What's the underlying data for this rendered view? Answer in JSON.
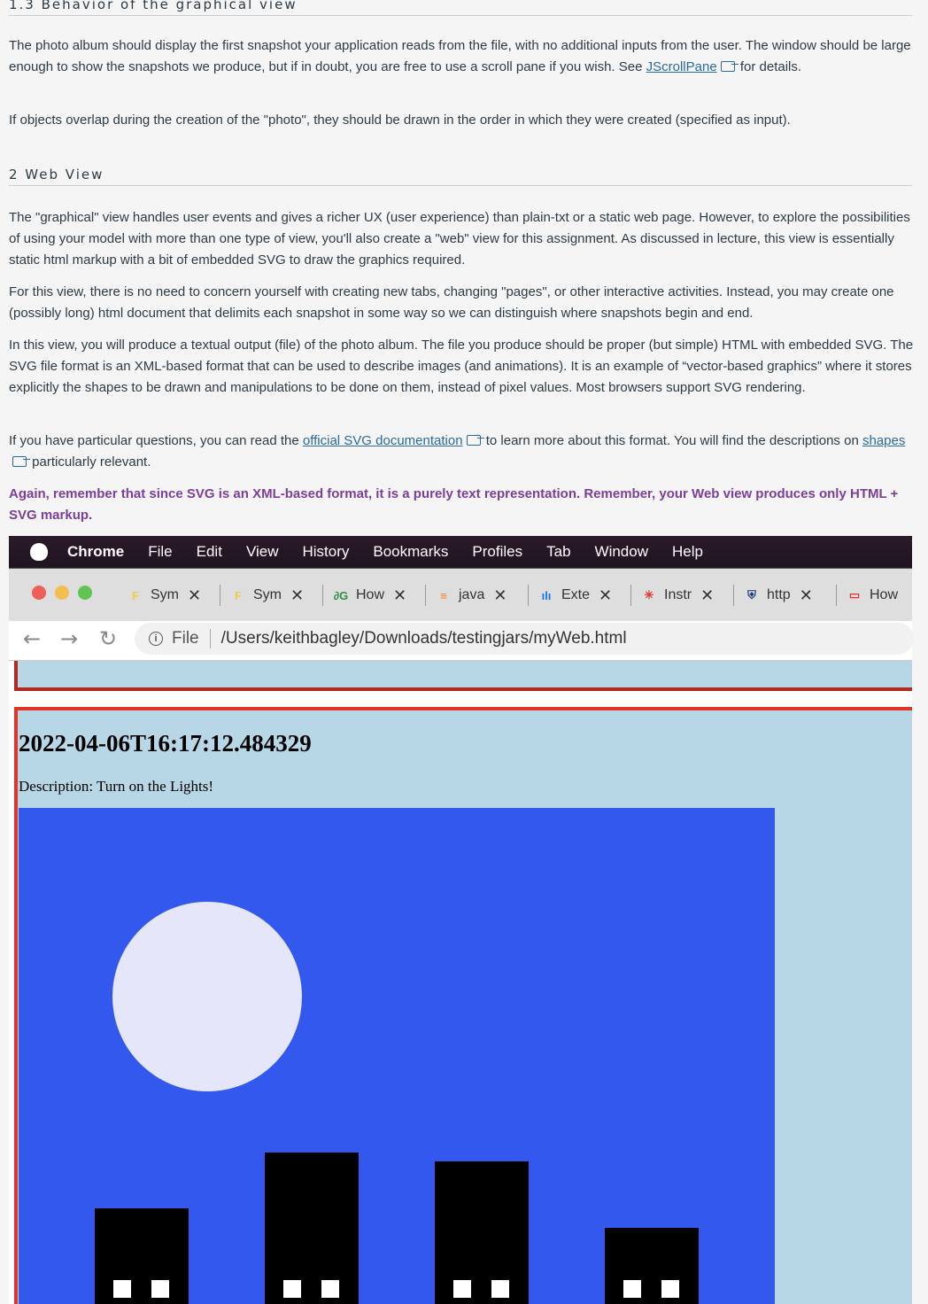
{
  "doc": {
    "section13_heading": "1.3     Behavior of the graphical view",
    "p1_text": "The photo album should display the first snapshot your application reads from the file, with no additional inputs from the user. The window should be large enough to show the snapshots we produce, but if in doubt, you are free to use a scroll pane if you wish. See ",
    "p1_link": "JScrollPane",
    "p1_tail": " for details.",
    "p2_text": "If objects overlap during the creation of the \"photo\", they should be drawn in the order in which they were created (specified as input).",
    "section2_heading": "2     Web View",
    "p3_text": "The \"graphical\" view handles user events and gives a richer UX (user experience) than plain-txt or a static web page. However, to explore the possibilities of using your model with more than one type of view, you'll also create a \"web\" view for this assignment. As discussed in lecture, this view is essentially static html markup with a bit of embedded SVG to draw the graphics required.",
    "p4_text": "For this view, there is no need to concern yourself with creating new tabs, changing \"pages\", or other interactive activities. Instead, you may create one (possibly long) html document that delimits each snapshot in some way so we can distinguish where snapshots begin and end.",
    "p5_text": "In this view, you will produce a textual output (file) of the photo album. The file you produce should be proper (but simple) HTML with embedded SVG. The SVG file format is an XML-based format that can be used to describe images (and animations). It is an example of “vector-based graphics” where it stores explicitly the shapes to be drawn and manipulations to be done on them, instead of pixel values. Most browsers support SVG rendering.",
    "p6_text_a": "If you have particular questions, you can read the ",
    "p6_link1": "official SVG documentation",
    "p6_text_b": " to learn more about this format. You will find the descriptions on ",
    "p6_link2": "shapes",
    "p6_text_c": " particularly relevant.",
    "p7_text": "Again, remember that since SVG is an XML-based format, it is a purely text representation. Remember, your Web view produces only HTML + SVG markup."
  },
  "menubar": {
    "app": "Chrome",
    "items": [
      "File",
      "Edit",
      "View",
      "History",
      "Bookmarks",
      "Profiles",
      "Tab",
      "Window",
      "Help"
    ]
  },
  "tabs": [
    {
      "label": "Sym",
      "icon": "figma-icon",
      "glyph": "F",
      "color": "#f2c94c"
    },
    {
      "label": "Sym",
      "icon": "figma-icon",
      "glyph": "F",
      "color": "#f2c94c"
    },
    {
      "label": "How",
      "icon": "geeks-icon",
      "glyph": "∂G",
      "color": "#2f8d46"
    },
    {
      "label": "java",
      "icon": "stackoverflow-icon",
      "glyph": "≡",
      "color": "#f48024"
    },
    {
      "label": "Exte",
      "icon": "chart-icon",
      "glyph": "ılı",
      "color": "#1a73e8"
    },
    {
      "label": "Instr",
      "icon": "canvas-icon",
      "glyph": "✳",
      "color": "#e03a2f"
    },
    {
      "label": "http",
      "icon": "shield-crest-icon",
      "glyph": "⛨",
      "color": "#1d3b7a"
    },
    {
      "label": "How",
      "icon": "oracle-icon",
      "glyph": "▭",
      "color": "#e0362a"
    }
  ],
  "urlbar": {
    "scheme_label": "File",
    "url": "/Users/keithbagley/Downloads/testingjars/myWeb.html"
  },
  "snapshot": {
    "timestamp": "2022-04-06T16:17:12.484329",
    "description": "Description: Turn on the Lights!"
  },
  "colors": {
    "sky": "#3358ee",
    "moon": "#e6e6fa",
    "page_bg": "#b8d7e6",
    "border": "#e0362a"
  }
}
